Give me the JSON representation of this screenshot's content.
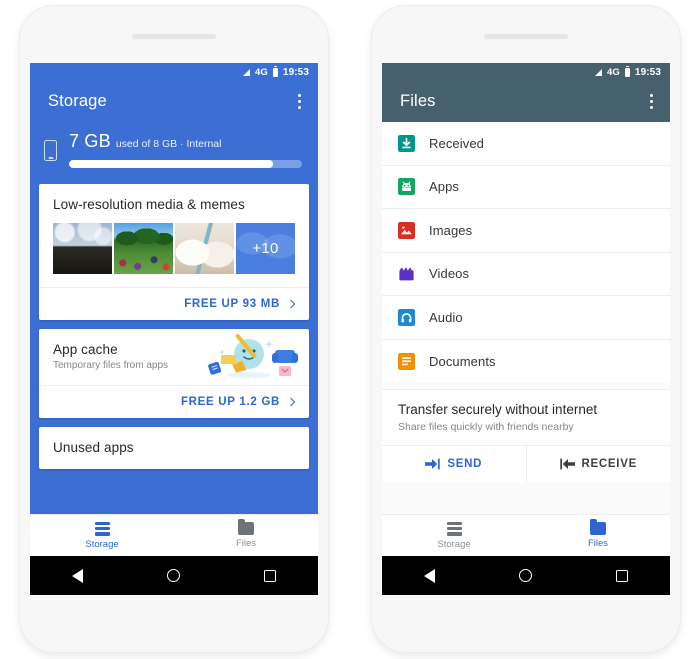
{
  "colors": {
    "storage_blue": "#3b6fd4",
    "files_header": "#47606d",
    "accent_blue": "#2d66d4",
    "android_black": "#000000",
    "card_white": "#ffffff",
    "bezel": "#f7f7f7"
  },
  "statusbar": {
    "network": "4G",
    "time": "19:53",
    "signal_icon": "signal-triangle-icon",
    "battery_icon": "battery-icon"
  },
  "left_phone": {
    "appbar": {
      "title": "Storage",
      "overflow_icon": "kebab-menu-icon"
    },
    "usage": {
      "device_icon": "phone-icon",
      "amount": "7 GB",
      "detail": "used of 8 GB · Internal",
      "percent_used": 87.5
    },
    "cards": [
      {
        "title": "Low-resolution media & memes",
        "thumbnails": [
          "beach-photo",
          "park-crowd-photo",
          "sleeping-cats-photo"
        ],
        "more_count": "+10",
        "action_label": "FREE UP 93 MB",
        "action_chevron": "chevron-right-icon"
      },
      {
        "title": "App cache",
        "subtitle": "Temporary files from apps",
        "illustration": "cleaning-broom-illustration",
        "action_label": "FREE UP 1.2 GB",
        "action_chevron": "chevron-right-icon"
      },
      {
        "title": "Unused apps"
      }
    ],
    "bottom_nav": [
      {
        "label": "Storage",
        "icon": "storage-list-icon",
        "active": true
      },
      {
        "label": "Files",
        "icon": "folder-icon",
        "active": false
      }
    ]
  },
  "right_phone": {
    "appbar": {
      "title": "Files",
      "overflow_icon": "kebab-menu-icon"
    },
    "file_categories": [
      {
        "label": "Received",
        "icon": "download-box-icon",
        "color": "#009688"
      },
      {
        "label": "Apps",
        "icon": "android-robot-icon",
        "color": "#11a662"
      },
      {
        "label": "Images",
        "icon": "image-icon",
        "color": "#d93025"
      },
      {
        "label": "Videos",
        "icon": "clapperboard-icon",
        "color": "#5c2fc2"
      },
      {
        "label": "Audio",
        "icon": "headphones-icon",
        "color": "#1e88d6"
      },
      {
        "label": "Documents",
        "icon": "document-lines-icon",
        "color": "#f29100"
      }
    ],
    "transfer": {
      "title": "Transfer securely without internet",
      "subtitle": "Share files quickly with friends nearby",
      "send_label": "SEND",
      "send_icon": "arrow-right-to-bar-icon",
      "receive_label": "RECEIVE",
      "receive_icon": "arrow-left-from-bar-icon"
    },
    "bottom_nav": [
      {
        "label": "Storage",
        "icon": "storage-list-icon",
        "active": false
      },
      {
        "label": "Files",
        "icon": "folder-icon",
        "active": true
      }
    ]
  },
  "android_nav": {
    "back": "back-triangle-icon",
    "home": "home-circle-icon",
    "recents": "recents-square-icon"
  }
}
